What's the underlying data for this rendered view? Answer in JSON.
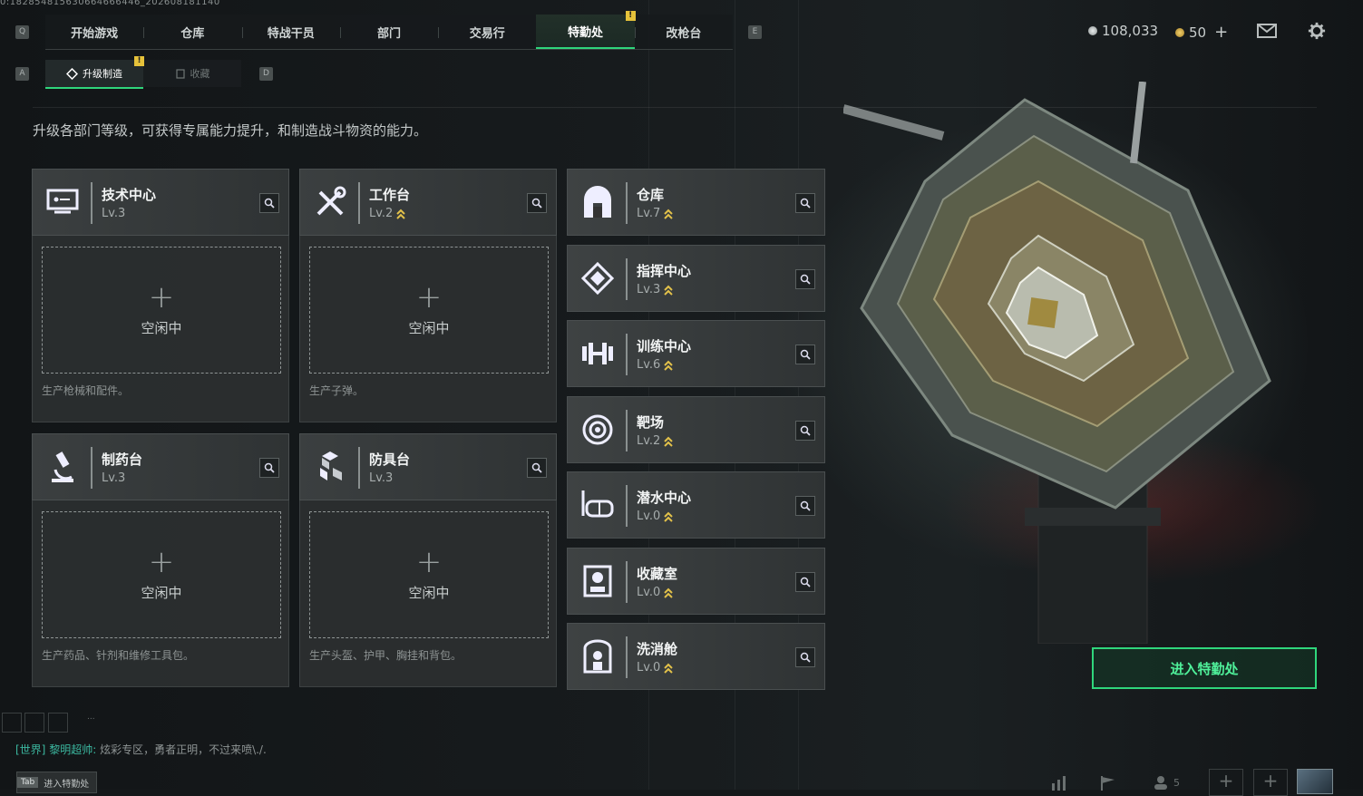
{
  "build_id": "0:182854815630664666446_202608181140",
  "top_nav": {
    "key_left": "Q",
    "key_right": "E",
    "tabs": [
      {
        "label": "开始游戏",
        "active": false
      },
      {
        "label": "仓库",
        "active": false
      },
      {
        "label": "特战干员",
        "active": false
      },
      {
        "label": "部门",
        "active": false
      },
      {
        "label": "交易行",
        "active": false
      },
      {
        "label": "特勤处",
        "active": true,
        "warning": "!"
      },
      {
        "label": "改枪台",
        "active": false
      }
    ]
  },
  "currency": {
    "credits": "108,033",
    "coins": "50",
    "add_symbol": "+"
  },
  "sub_nav": {
    "key_left": "A",
    "key_right": "D",
    "tabs": [
      {
        "label": "升级制造",
        "active": true,
        "warning": "!"
      },
      {
        "label": "收藏",
        "active": false
      }
    ]
  },
  "description": "升级各部门等级，可获得专属能力提升，和制造战斗物资的能力。",
  "workstations": [
    {
      "name": "技术中心",
      "level": "Lv.3",
      "icon": "computer-icon",
      "upgradeable": false,
      "slot_label": "空闲中",
      "slot_plus": "+",
      "desc": "生产枪械和配件。"
    },
    {
      "name": "工作台",
      "level": "Lv.2",
      "icon": "tools-icon",
      "upgradeable": true,
      "slot_label": "空闲中",
      "slot_plus": "+",
      "desc": "生产子弹。"
    },
    {
      "name": "制药台",
      "level": "Lv.3",
      "icon": "microscope-icon",
      "upgradeable": false,
      "slot_label": "空闲中",
      "slot_plus": "+",
      "desc": "生产药品、针剂和维修工具包。"
    },
    {
      "name": "防具台",
      "level": "Lv.3",
      "icon": "armor-cubes-icon",
      "upgradeable": false,
      "slot_label": "空闲中",
      "slot_plus": "+",
      "desc": "生产头盔、护甲、胸挂和背包。"
    }
  ],
  "departments": [
    {
      "name": "仓库",
      "level": "Lv.7",
      "icon": "vault-icon"
    },
    {
      "name": "指挥中心",
      "level": "Lv.3",
      "icon": "command-chip-icon"
    },
    {
      "name": "训练中心",
      "level": "Lv.6",
      "icon": "dumbbell-icon"
    },
    {
      "name": "靶场",
      "level": "Lv.2",
      "icon": "target-icon"
    },
    {
      "name": "潜水中心",
      "level": "Lv.0",
      "icon": "diving-mask-icon"
    },
    {
      "name": "收藏室",
      "level": "Lv.0",
      "icon": "display-case-icon"
    },
    {
      "name": "洗消舱",
      "level": "Lv.0",
      "icon": "decon-chamber-icon"
    }
  ],
  "enter_button": "进入特勤处",
  "chat": {
    "channel": "[世界]",
    "sender": "黎明超帅:",
    "message": "炫彩专区，勇者正明，不过来喷\\./.",
    "dots": "..."
  },
  "tab_hint": {
    "key": "Tab",
    "label": "进入特勤处"
  },
  "friends_count": "5",
  "colors": {
    "accent": "#2fd67c",
    "warning": "#e6c23a",
    "upgrade_chevron": "#e2c14a"
  }
}
